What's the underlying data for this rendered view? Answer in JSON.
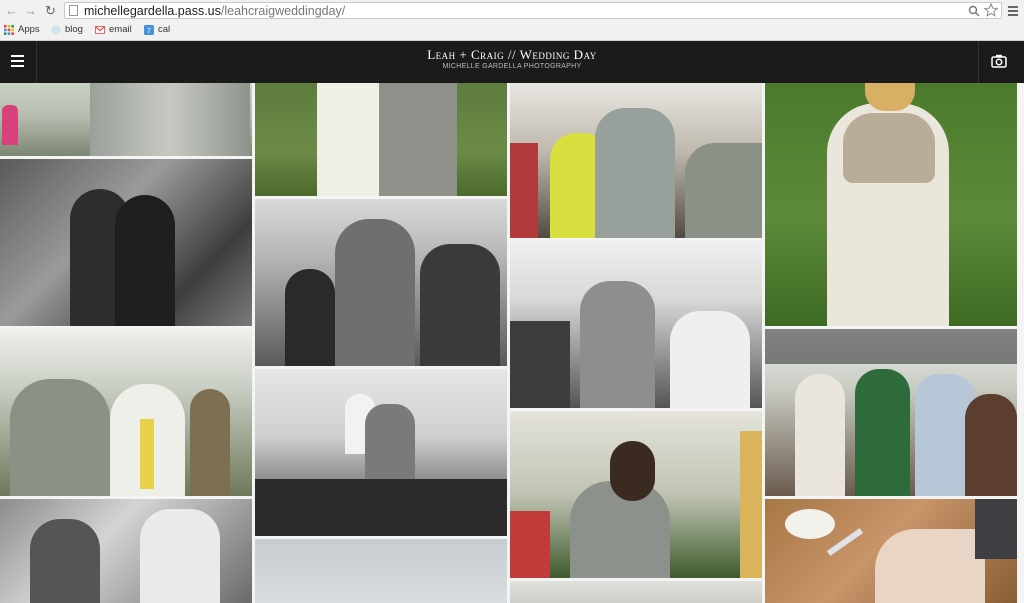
{
  "browser": {
    "back_icon": "back-arrow-icon",
    "forward_icon": "forward-arrow-icon",
    "reload_icon": "reload-icon",
    "url_host": "michellegardella.pass.us",
    "url_path": "/leahcraigweddingday/",
    "bookmarks": [
      {
        "label": "Apps",
        "icon": "apps-grid-icon"
      },
      {
        "label": "blog",
        "icon": "globe-icon"
      },
      {
        "label": "email",
        "icon": "gmail-icon"
      },
      {
        "label": "cal",
        "icon": "calendar-icon"
      }
    ]
  },
  "site": {
    "title": "Leah + Craig // Wedding Day",
    "subtitle": "MICHELLE GARDELLA PHOTOGRAPHY",
    "menu_icon": "hamburger-menu-icon",
    "camera_icon": "camera-icon"
  },
  "gallery": {
    "photos": [
      {
        "col": 1,
        "style": "color",
        "subject": "guests hugging"
      },
      {
        "col": 1,
        "style": "bw",
        "subject": "groom hugging woman"
      },
      {
        "col": 1,
        "style": "color",
        "subject": "dancing guests"
      },
      {
        "col": 1,
        "style": "bw",
        "subject": "dance circle"
      },
      {
        "col": 2,
        "style": "color",
        "subject": "couple on lawn"
      },
      {
        "col": 2,
        "style": "bw",
        "subject": "groom dancing"
      },
      {
        "col": 2,
        "style": "bw",
        "subject": "couple lifted on chairs"
      },
      {
        "col": 2,
        "style": "color",
        "subject": "sky"
      },
      {
        "col": 3,
        "style": "color",
        "subject": "groom dancing with guest"
      },
      {
        "col": 3,
        "style": "bw",
        "subject": "groom cheering"
      },
      {
        "col": 3,
        "style": "color",
        "subject": "couple kissing"
      },
      {
        "col": 3,
        "style": "color",
        "subject": "tent"
      },
      {
        "col": 4,
        "style": "color",
        "subject": "bride hugging"
      },
      {
        "col": 4,
        "style": "color",
        "subject": "guests watching"
      },
      {
        "col": 4,
        "style": "color",
        "subject": "table setting"
      }
    ]
  }
}
